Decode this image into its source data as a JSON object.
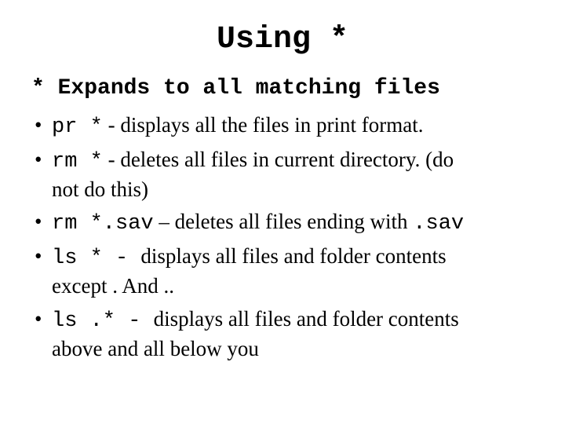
{
  "title": "Using *",
  "subheading": "* Expands to all matching files",
  "bullets": [
    {
      "cmd": "pr *",
      "sep": " - ",
      "desc": "displays all the files in print format.",
      "cont": ""
    },
    {
      "cmd": "rm *",
      "sep": " - ",
      "desc": "deletes all files in current directory. (do",
      "cont": "not do this)"
    },
    {
      "cmd": "rm *.sav",
      "sep": " – ",
      "desc": "deletes all files ending with ",
      "trailing_cmd": ".sav",
      "cont": ""
    },
    {
      "cmd": "ls *",
      "sep": " -  ",
      "desc": "displays all files and folder contents",
      "cont": "except . And .."
    },
    {
      "cmd": "ls .*",
      "sep": " -  ",
      "desc": "displays all files and folder contents",
      "cont": "above and all below you"
    }
  ]
}
